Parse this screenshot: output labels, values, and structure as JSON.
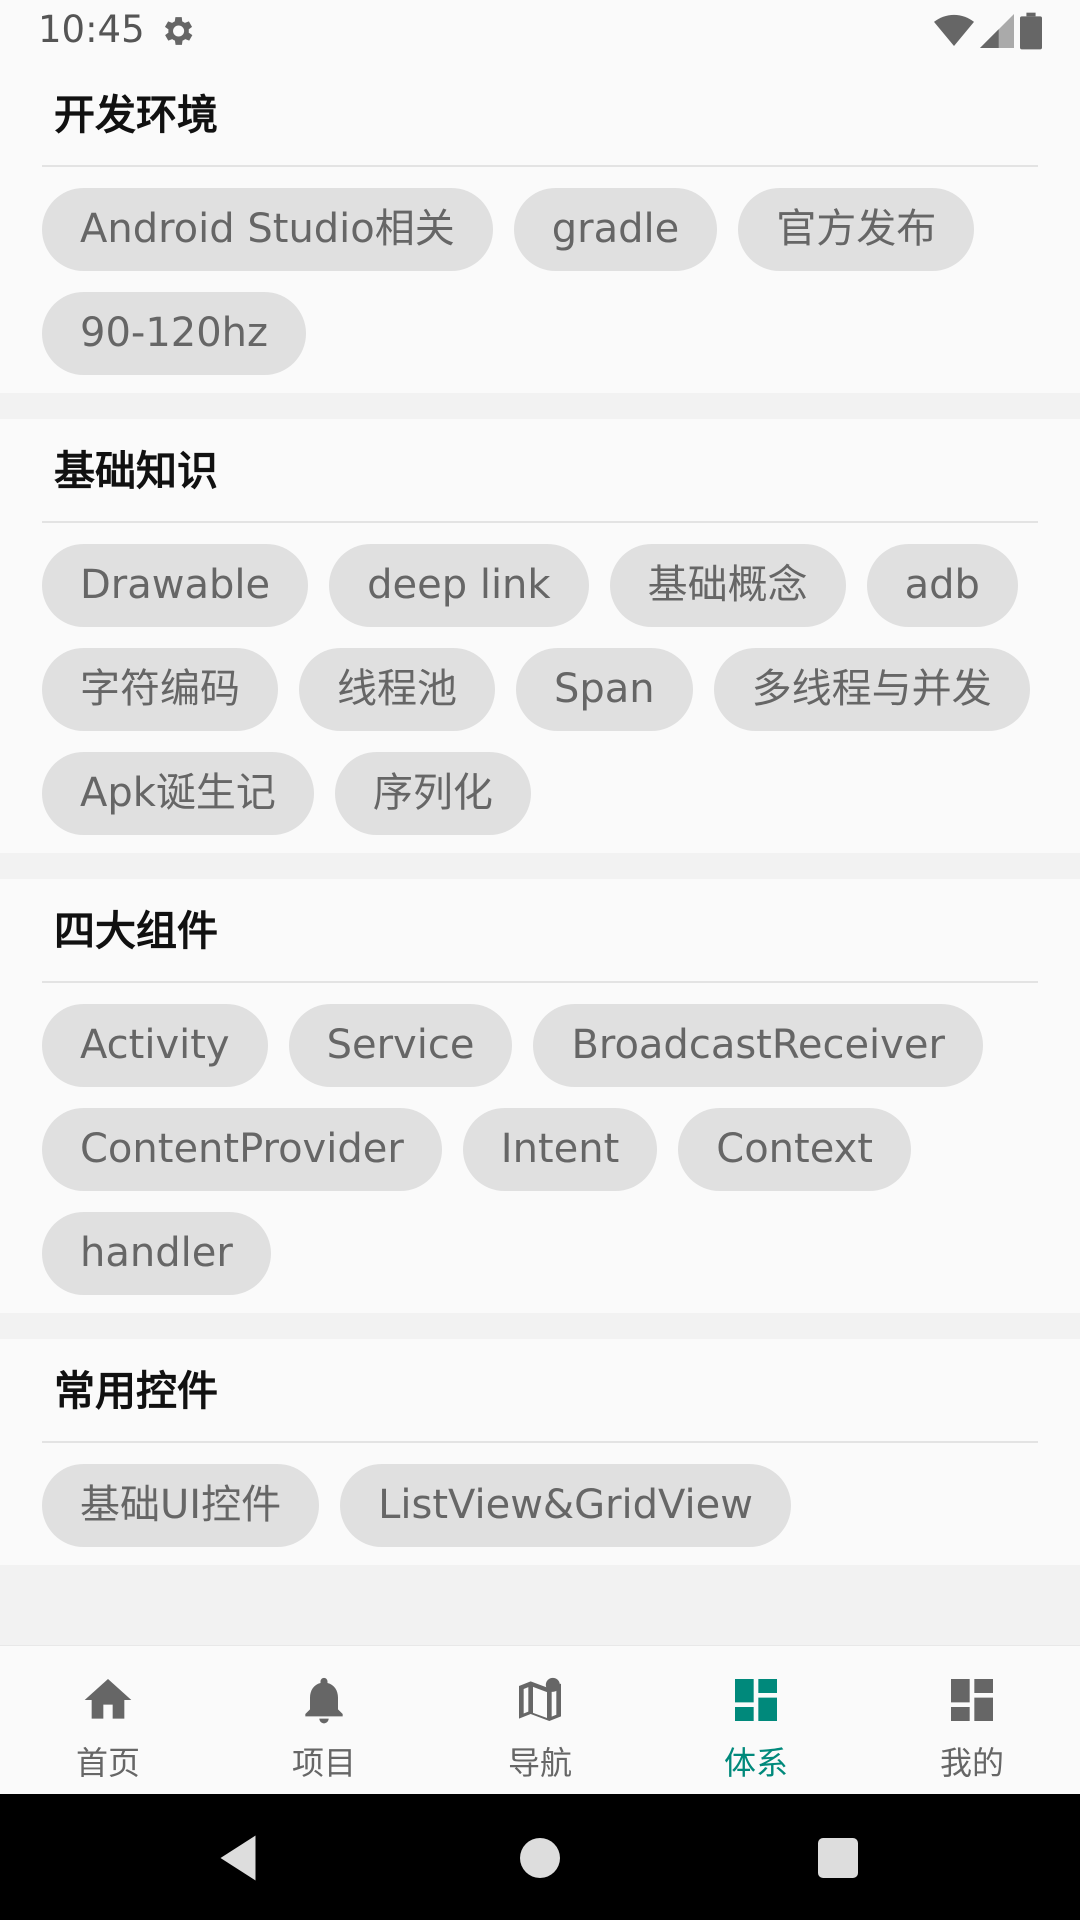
{
  "status_bar": {
    "time": "10:45",
    "icons": [
      "gear-icon",
      "wifi-icon",
      "signal-icon",
      "battery-icon"
    ]
  },
  "sections": [
    {
      "title": "开发环境",
      "chips": [
        "Android Studio相关",
        "gradle",
        "官方发布",
        "90-120hz"
      ]
    },
    {
      "title": "基础知识",
      "chips": [
        "Drawable",
        "deep link",
        "基础概念",
        "adb",
        "字符编码",
        "线程池",
        "Span",
        "多线程与并发",
        "Apk诞生记",
        "序列化"
      ]
    },
    {
      "title": "四大组件",
      "chips": [
        "Activity",
        "Service",
        "BroadcastReceiver",
        "ContentProvider",
        "Intent",
        "Context",
        "handler"
      ]
    },
    {
      "title": "常用控件",
      "chips": [
        "基础UI控件",
        "ListView&GridView"
      ]
    }
  ],
  "bottom_nav": {
    "active_color": "#00897b",
    "inactive_color": "#666666",
    "items": [
      {
        "label": "首页",
        "icon": "home-icon",
        "active": false
      },
      {
        "label": "项目",
        "icon": "bell-icon",
        "active": false
      },
      {
        "label": "导航",
        "icon": "map-icon",
        "active": false
      },
      {
        "label": "体系",
        "icon": "dashboard-icon",
        "active": true
      },
      {
        "label": "我的",
        "icon": "dashboard-icon",
        "active": false
      }
    ]
  },
  "system_nav": [
    "back-icon",
    "home-circle-icon",
    "recents-icon"
  ]
}
